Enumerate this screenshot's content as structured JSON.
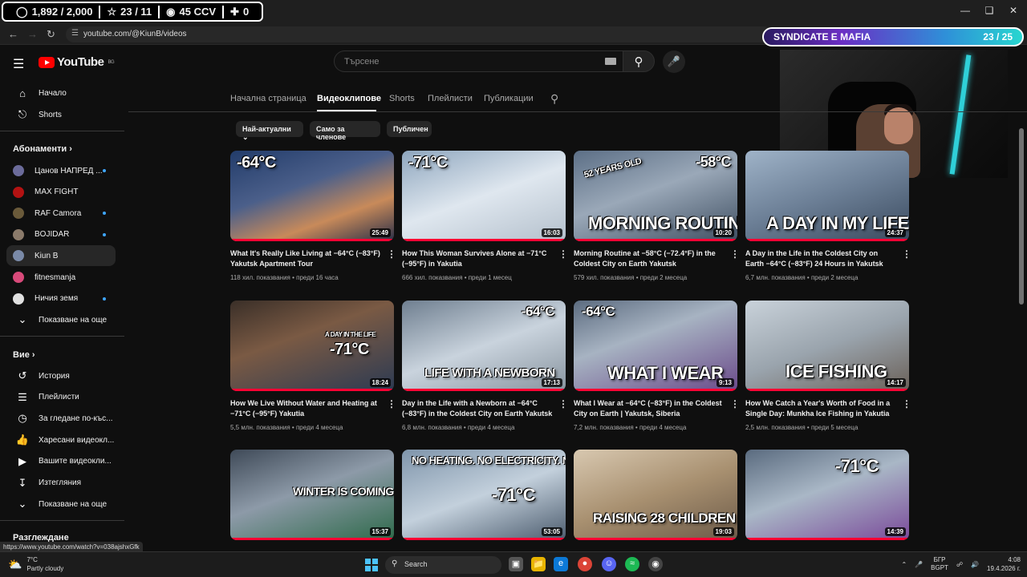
{
  "stream_stats": {
    "followers": "1,892 / 2,000",
    "subs": "23 / 11",
    "viewers": "45 CCV",
    "extra": "0"
  },
  "overlay": {
    "title": "SYNDICATE E MAFIA",
    "count": "23 / 25"
  },
  "browser": {
    "url": "youtube.com/@KiunB/videos",
    "status_url": "https://www.youtube.com/watch?v=038ajshxGfk"
  },
  "youtube": {
    "logo_text": "YouTube",
    "region": "BG",
    "search_placeholder": "Търсене"
  },
  "sidebar": {
    "main": [
      {
        "label": "Начало",
        "icon": "home-icon"
      },
      {
        "label": "Shorts",
        "icon": "shorts-icon"
      }
    ],
    "subs_header": "Абонаменти",
    "subs": [
      {
        "label": "Цанов НАПРЕД ...",
        "color": "#6b6b9a",
        "dot": true
      },
      {
        "label": "MAX FIGHT",
        "color": "#b31212",
        "dot": false
      },
      {
        "label": "RAF Camora",
        "color": "#6a5a3a",
        "dot": true
      },
      {
        "label": "BOJIDAR",
        "color": "#8a7a6a",
        "dot": true
      },
      {
        "label": "Kiun B",
        "color": "#7a8aa8",
        "dot": false,
        "active": true
      },
      {
        "label": "fitnesmanja",
        "color": "#d84a7a",
        "dot": false
      },
      {
        "label": "Ничия земя",
        "color": "#e0e0e0",
        "dot": true
      }
    ],
    "subs_more": "Показване на още",
    "you_header": "Вие",
    "you": [
      {
        "label": "История",
        "icon": "history-icon"
      },
      {
        "label": "Плейлисти",
        "icon": "playlist-icon"
      },
      {
        "label": "За гледане по-къс...",
        "icon": "watch-later-icon"
      },
      {
        "label": "Харесани видеокл...",
        "icon": "like-icon"
      },
      {
        "label": "Вашите видеокли...",
        "icon": "your-videos-icon"
      },
      {
        "label": "Изтегляния",
        "icon": "download-icon"
      }
    ],
    "you_more": "Показване на още",
    "explore_header": "Разглеждане"
  },
  "channel_tabs": [
    "Начална страница",
    "Видеоклипове",
    "Shorts",
    "Плейлисти",
    "Публикации"
  ],
  "chips": [
    "Най-актуални",
    "Само за членове",
    "Публичен"
  ],
  "videos": [
    {
      "title": "What It's Really Like Living at −64°C (−83°F) Yakutsk Apartment Tour",
      "views": "118 хил. показвания",
      "age": "преди 16 часа",
      "duration": "25:49",
      "caption": "-64°C",
      "sub": ""
    },
    {
      "title": "How This Woman Survives Alone at −71°C (−95°F) in Yakutia",
      "views": "666 хил. показвания",
      "age": "преди 1 месец",
      "duration": "16:03",
      "caption": "-71°C",
      "sub": ""
    },
    {
      "title": "Morning Routine at −58°C (−72.4°F) in the Coldest City on Earth Yakutsk",
      "views": "579 хил. показвания",
      "age": "преди 2 месеца",
      "duration": "10:20",
      "caption": "MORNING ROUTINE",
      "sub": "-58°C",
      "tag": "52 YEARS OLD"
    },
    {
      "title": "A Day in the Life in the Coldest City on Earth −64°C (−83°F) 24 Hours in Yakutsk",
      "views": "6,7 млн. показвания",
      "age": "преди 2 месеца",
      "duration": "24:37",
      "caption": "A DAY IN MY LIFE",
      "sub": ""
    },
    {
      "title": "How We Live Without Water and Heating at −71°C (−95°F) Yakutia",
      "views": "5,5 млн. показвания",
      "age": "преди 4 месеца",
      "duration": "18:24",
      "caption": "-71°C",
      "sub": "A DAY IN THE LIFE"
    },
    {
      "title": "Day in the Life with a Newborn at −64°C (−83°F) in the Coldest City on Earth Yakutsk",
      "views": "6,8 млн. показвания",
      "age": "преди 4 месеца",
      "duration": "17:13",
      "caption": "LIFE WITH A NEWBORN",
      "sub": "-64°C"
    },
    {
      "title": "What I Wear at −64°C (−83°F) in the Coldest City on Earth | Yakutsk, Siberia",
      "views": "7,2 млн. показвания",
      "age": "преди 4 месеца",
      "duration": "9:13",
      "caption": "WHAT I WEAR",
      "sub": "-64°C"
    },
    {
      "title": "How We Catch a Year's Worth of Food in a Single Day: Munkha Ice Fishing in Yakutia",
      "views": "2,5 млн. показвания",
      "age": "преди 5 месеца",
      "duration": "14:17",
      "caption": "ICE FISHING",
      "sub": ""
    },
    {
      "title": "",
      "views": "",
      "age": "",
      "duration": "15:37",
      "caption": "WINTER IS COMING",
      "sub": ""
    },
    {
      "title": "",
      "views": "",
      "age": "",
      "duration": "53:05",
      "caption": "-71°C",
      "sub": "NO HEATING. NO ELECTRICITY. NO PEOPLE."
    },
    {
      "title": "",
      "views": "",
      "age": "",
      "duration": "19:03",
      "caption": "RAISING 28 CHILDREN",
      "sub": ""
    },
    {
      "title": "",
      "views": "",
      "age": "",
      "duration": "14:39",
      "caption": "-71°C",
      "sub": ""
    }
  ],
  "taskbar": {
    "temp": "7°C",
    "weather": "Partly cloudy",
    "search": "Search",
    "lang1": "БГР",
    "lang2": "BGPT",
    "time": "4:08",
    "date": "19.4.2026 г."
  },
  "colors": {
    "accent_red": "#ff0033",
    "bg": "#0f0f0f",
    "blue_dot": "#3ea6ff"
  }
}
